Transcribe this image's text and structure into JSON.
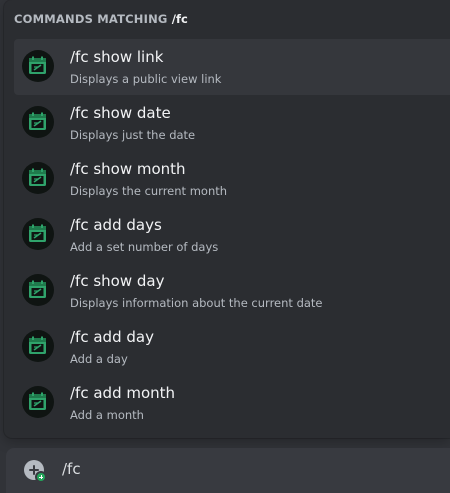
{
  "header": {
    "prefix": "COMMANDS MATCHING",
    "query": "/fc"
  },
  "commands": [
    {
      "name": "/fc show link",
      "description": "Displays a public view link",
      "icon": "bot-calendar-icon",
      "selected": true
    },
    {
      "name": "/fc show date",
      "description": "Displays just the date",
      "icon": "bot-calendar-icon",
      "selected": false
    },
    {
      "name": "/fc show month",
      "description": "Displays the current month",
      "icon": "bot-calendar-icon",
      "selected": false
    },
    {
      "name": "/fc add days",
      "description": "Add a set number of days",
      "icon": "bot-calendar-icon",
      "selected": false
    },
    {
      "name": "/fc show day",
      "description": "Displays information about the current date",
      "icon": "bot-calendar-icon",
      "selected": false
    },
    {
      "name": "/fc add day",
      "description": "Add a day",
      "icon": "bot-calendar-icon",
      "selected": false
    },
    {
      "name": "/fc add month",
      "description": "Add a month",
      "icon": "bot-calendar-icon",
      "selected": false
    }
  ],
  "input": {
    "value": "/fc",
    "add_icon": "plus-circle-icon"
  },
  "colors": {
    "background": "#313338",
    "popup": "#2b2d31",
    "selected_row": "#35373c",
    "input_bar": "#383a40",
    "icon_green": "#23a55a"
  }
}
